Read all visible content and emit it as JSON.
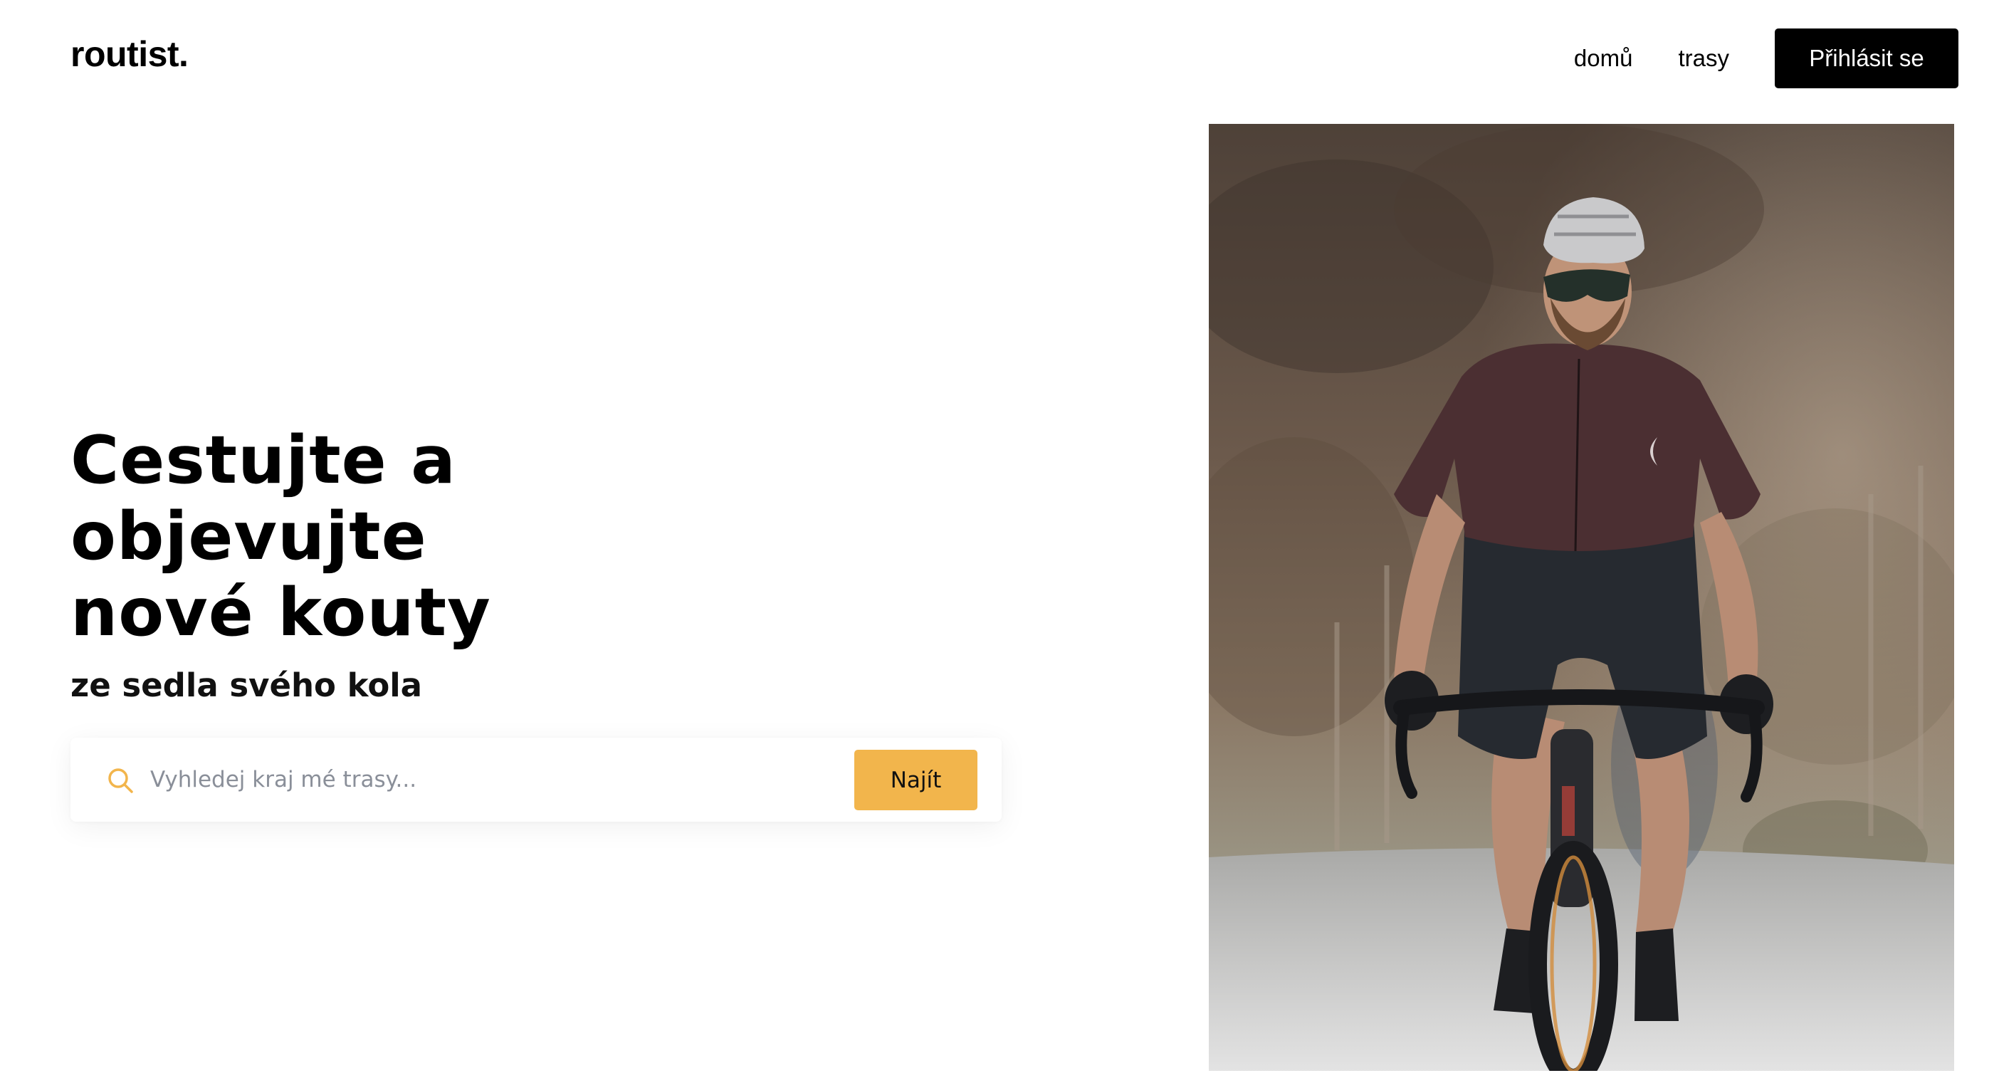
{
  "header": {
    "logo": "routist.",
    "nav": [
      {
        "label": "domů"
      },
      {
        "label": "trasy"
      }
    ],
    "login_label": "Přihlásit se"
  },
  "hero": {
    "title": "Cestujte a objevujte nové kouty",
    "subtitle": "ze sedla svého kola",
    "search": {
      "placeholder": "Vyhledej kraj mé trasy...",
      "value": "",
      "button_label": "Najít",
      "icon": "search-icon"
    },
    "image_alt": "cyclist-photo",
    "image_icon": "cyclist-photo"
  },
  "colors": {
    "accent": "#f2b54c",
    "login_bg": "#000000",
    "text": "#000000",
    "placeholder": "#8a8f99"
  }
}
